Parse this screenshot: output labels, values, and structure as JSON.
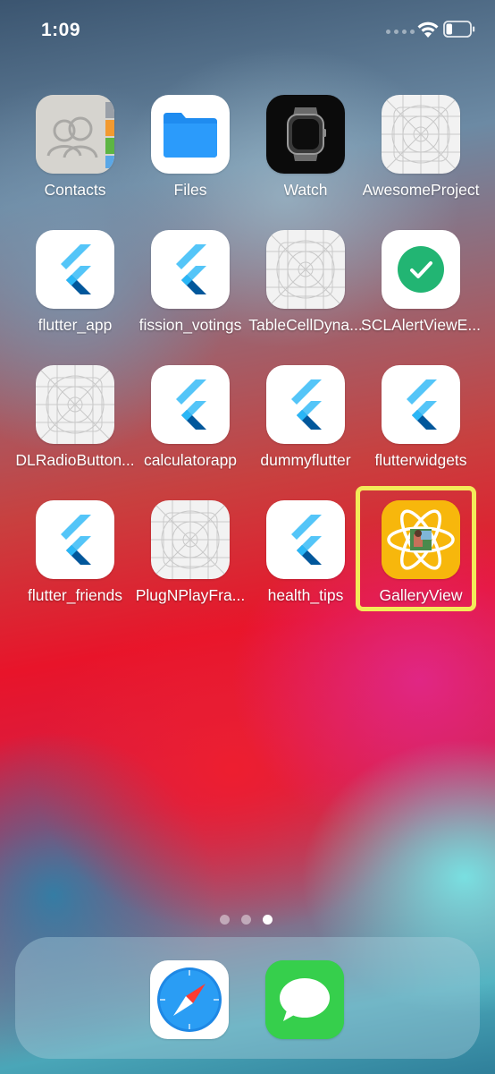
{
  "status_bar": {
    "time": "1:09"
  },
  "apps": [
    {
      "label": "Contacts",
      "icon": "contacts-icon"
    },
    {
      "label": "Files",
      "icon": "files-icon"
    },
    {
      "label": "Watch",
      "icon": "watch-icon"
    },
    {
      "label": "AwesomeProject",
      "icon": "placeholder-app-icon"
    },
    {
      "label": "flutter_app",
      "icon": "flutter-icon"
    },
    {
      "label": "fission_votings",
      "icon": "flutter-icon"
    },
    {
      "label": "TableCellDyna...",
      "icon": "placeholder-app-icon"
    },
    {
      "label": "SCLAlertViewE...",
      "icon": "checkmark-icon"
    },
    {
      "label": "DLRadioButton...",
      "icon": "placeholder-app-icon"
    },
    {
      "label": "calculatorapp",
      "icon": "flutter-icon"
    },
    {
      "label": "dummyflutter",
      "icon": "flutter-icon"
    },
    {
      "label": "flutterwidgets",
      "icon": "flutter-icon"
    },
    {
      "label": "flutter_friends",
      "icon": "flutter-icon"
    },
    {
      "label": "PlugNPlayFra...",
      "icon": "placeholder-app-icon"
    },
    {
      "label": "health_tips",
      "icon": "flutter-icon"
    },
    {
      "label": "GalleryView",
      "icon": "gallery-atom-icon"
    }
  ],
  "page_dots": {
    "count": 3,
    "active_index": 2
  },
  "dock": [
    {
      "icon": "safari-icon"
    },
    {
      "icon": "messages-icon"
    }
  ],
  "highlight_color": "#f3ea59"
}
